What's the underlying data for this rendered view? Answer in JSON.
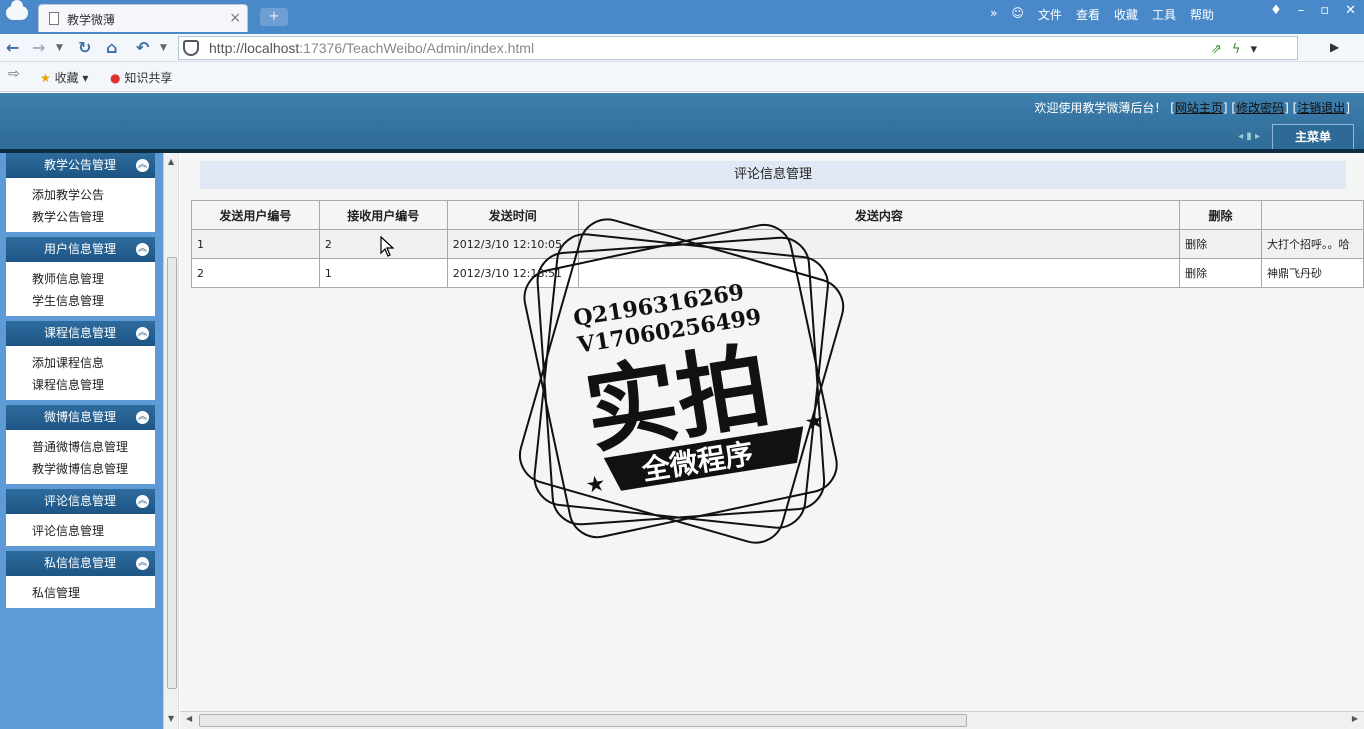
{
  "browser": {
    "tab_title": "教学微薄",
    "tab_close": "×",
    "new_tab": "+",
    "url_host": "http://localhost",
    "url_rest": ":17376/TeachWeibo/Admin/index.html",
    "menu": [
      "文件",
      "查看",
      "收藏",
      "工具",
      "帮助"
    ],
    "favorites_label": "收藏",
    "favorites_item": "知识共享"
  },
  "header": {
    "welcome_text": "欢迎使用教学微薄后台！",
    "links": [
      "网站主页",
      "修改密码",
      "注销退出"
    ],
    "main_menu_tab": "主菜单"
  },
  "sidebar": {
    "groups": [
      {
        "title": "教学公告管理",
        "items": [
          "添加教学公告",
          "教学公告管理"
        ]
      },
      {
        "title": "用户信息管理",
        "items": [
          "教师信息管理",
          "学生信息管理"
        ]
      },
      {
        "title": "课程信息管理",
        "items": [
          "添加课程信息",
          "课程信息管理"
        ]
      },
      {
        "title": "微博信息管理",
        "items": [
          "普通微博信息管理",
          "教学微博信息管理"
        ]
      },
      {
        "title": "评论信息管理",
        "items": [
          "评论信息管理"
        ]
      },
      {
        "title": "私信信息管理",
        "items": [
          "私信管理"
        ]
      }
    ]
  },
  "main": {
    "title": "评论信息管理",
    "columns": [
      "发送用户编号",
      "接收用户编号",
      "发送时间",
      "发送内容",
      "删除",
      ""
    ],
    "rows": [
      {
        "sender": "1",
        "receiver": "2",
        "time": "2012/3/10 12:10:05",
        "content": "",
        "delete": "删除",
        "extra": "大打个招呼。。哈"
      },
      {
        "sender": "2",
        "receiver": "1",
        "time": "2012/3/10 12:18:51",
        "content": "",
        "delete": "删除",
        "extra": "神鼎飞丹砂"
      }
    ]
  },
  "watermark": {
    "line1": "Q2196316269",
    "line2": "V17060256499",
    "big": "实拍",
    "banner": "全微程序"
  }
}
